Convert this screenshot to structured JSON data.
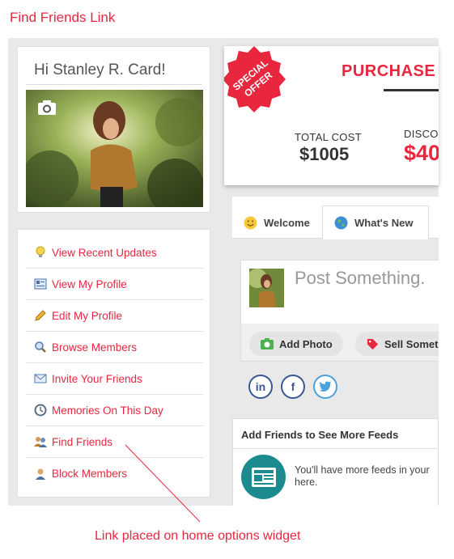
{
  "page_title": "Find Friends Link",
  "greeting": "Hi Stanley R. Card!",
  "menu": [
    {
      "label": "View Recent Updates",
      "icon": "lightbulb-icon"
    },
    {
      "label": "View My Profile",
      "icon": "profile-card-icon"
    },
    {
      "label": "Edit My Profile",
      "icon": "pencil-icon"
    },
    {
      "label": "Browse Members",
      "icon": "magnifier-icon"
    },
    {
      "label": "Invite Your Friends",
      "icon": "envelope-icon"
    },
    {
      "label": "Memories On This Day",
      "icon": "clock-icon"
    },
    {
      "label": "Find Friends",
      "icon": "users-icon"
    },
    {
      "label": "Block Members",
      "icon": "user-icon"
    }
  ],
  "offer": {
    "badge_line1": "SPECIAL",
    "badge_line2": "OFFER",
    "title": "PURCHASE A",
    "total_label": "TOTAL COST",
    "total_value": "$1005",
    "discount_label": "DISCO",
    "discount_value": "$40"
  },
  "tabs": [
    {
      "label": "Welcome",
      "icon": "smiley-icon"
    },
    {
      "label": "What's New",
      "icon": "globe-icon",
      "active": true
    }
  ],
  "composer": {
    "placeholder": "Post Something.",
    "add_photo": "Add Photo",
    "sell": "Sell Somet"
  },
  "social": [
    "in",
    "f",
    "twitter"
  ],
  "friends_widget": {
    "title": "Add Friends to See More Feeds",
    "text": "You'll have more feeds in your here."
  },
  "annotation": "Link placed on home options widget",
  "colors": {
    "accent": "#e8273f",
    "teal": "#1b8b8f",
    "facebook": "#3a5795",
    "twitter": "#4aa3df"
  }
}
